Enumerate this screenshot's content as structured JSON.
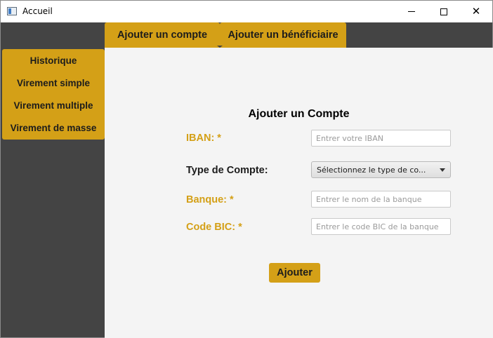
{
  "window": {
    "title": "Accueil",
    "icon": "app-window-icon",
    "controls": {
      "minimize": "minimize-icon",
      "maximize": "maximize-icon",
      "close": "close-icon"
    }
  },
  "tabs": [
    {
      "label": "Ajouter un compte",
      "active": true
    },
    {
      "label": "Ajouter un bénéficiaire",
      "active": false
    }
  ],
  "sidebar": {
    "items": [
      {
        "label": "Historique"
      },
      {
        "label": "Virement simple"
      },
      {
        "label": "Virement multiple"
      },
      {
        "label": "Virement de masse"
      }
    ]
  },
  "form": {
    "title": "Ajouter un Compte",
    "iban": {
      "label": "IBAN: *",
      "placeholder": "Entrer votre IBAN",
      "value": ""
    },
    "account_type": {
      "label": "Type de Compte:",
      "selected": "Sélectionnez le type de co..."
    },
    "bank": {
      "label": "Banque: *",
      "placeholder": "Entrer le nom de la banque",
      "value": ""
    },
    "bic": {
      "label": "Code BIC: *",
      "placeholder": "Entrer le code BIC de la banque",
      "value": ""
    },
    "submit_label": "Ajouter"
  },
  "colors": {
    "accent": "#d4a017",
    "background_dark": "#444444",
    "content_background": "#f4f4f4"
  }
}
